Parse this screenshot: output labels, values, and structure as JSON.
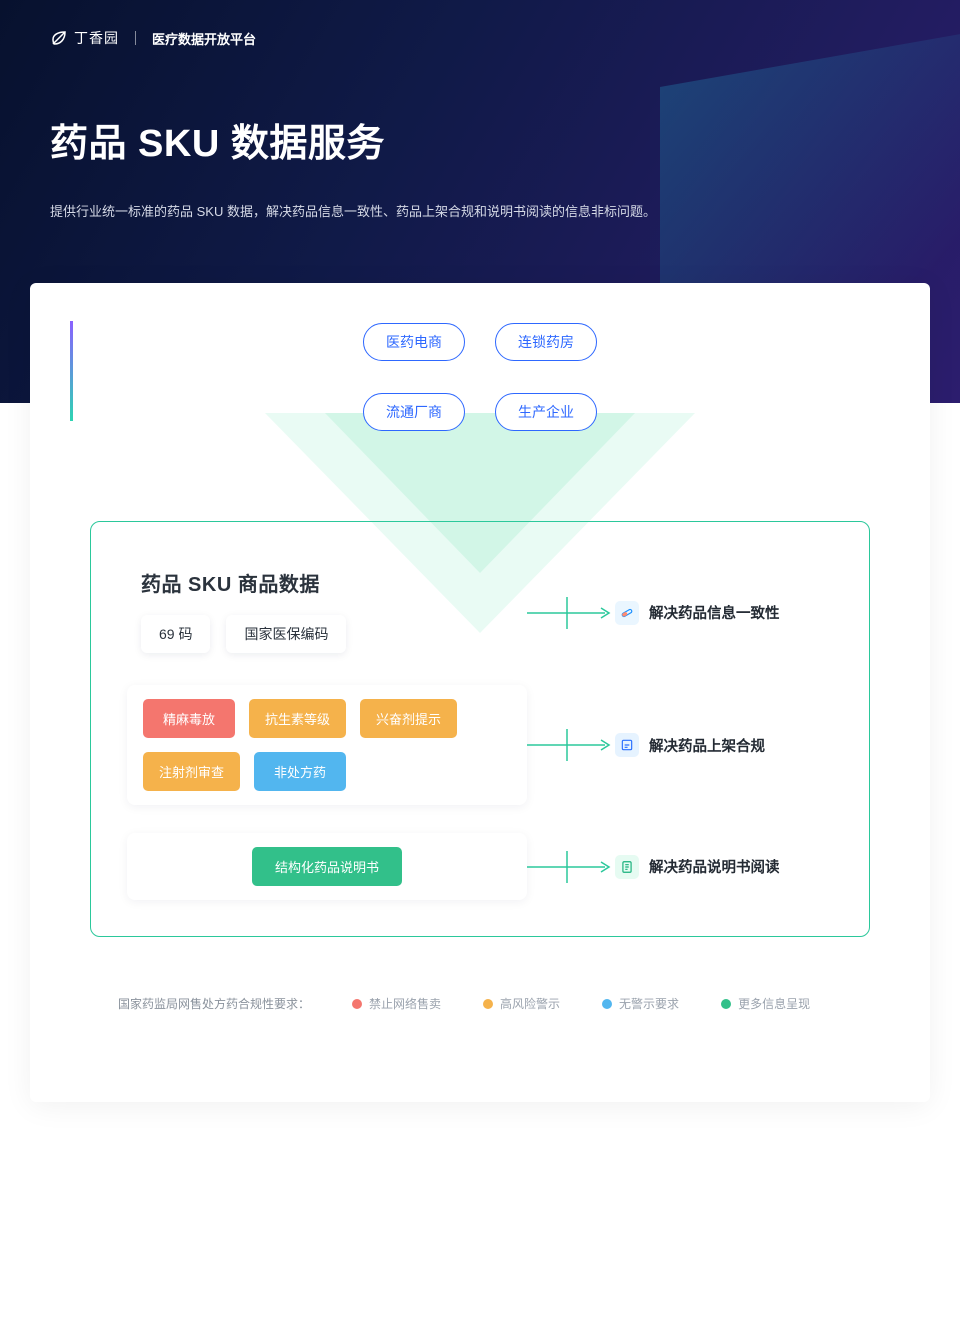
{
  "logo": {
    "brand": "丁香园",
    "platform": "医疗数据开放平台"
  },
  "hero": {
    "title": "药品 SKU 数据服务",
    "desc": "提供行业统一标准的药品 SKU 数据，解决药品信息一致性、药品上架合规和说明书阅读的信息非标问题。"
  },
  "sources": {
    "row1": [
      "医药电商",
      "连锁药房"
    ],
    "row2": [
      "流通厂商",
      "生产企业"
    ]
  },
  "diagram": {
    "title": "药品 SKU 商品数据",
    "codes": [
      "69 码",
      "国家医保编码"
    ],
    "tags_row1": [
      {
        "label": "精麻毒放",
        "color": "red"
      },
      {
        "label": "抗生素等级",
        "color": "orange"
      },
      {
        "label": "兴奋剂提示",
        "color": "orange"
      }
    ],
    "tags_row2": [
      {
        "label": "注射剂审查",
        "color": "orange"
      },
      {
        "label": "非处方药",
        "color": "blue"
      }
    ],
    "manual_tag": {
      "label": "结构化药品说明书",
      "color": "green"
    },
    "right": [
      {
        "icon": "pill",
        "text": "解决药品信息一致性"
      },
      {
        "icon": "square",
        "text": "解决药品上架合规"
      },
      {
        "icon": "doc",
        "text": "解决药品说明书阅读"
      }
    ]
  },
  "legend": {
    "label": "国家药监局网售处方药合规性要求：",
    "items": [
      {
        "color": "red",
        "text": "禁止网络售卖"
      },
      {
        "color": "orange",
        "text": "高风险警示"
      },
      {
        "color": "blue",
        "text": "无警示要求"
      },
      {
        "color": "green",
        "text": "更多信息呈现"
      }
    ]
  }
}
